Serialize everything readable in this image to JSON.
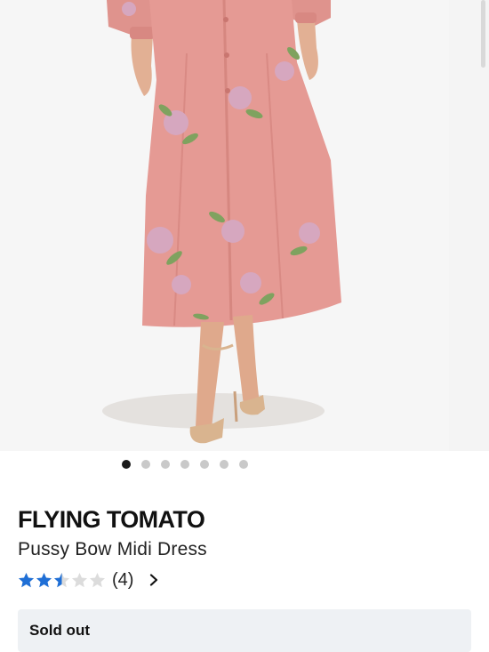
{
  "product": {
    "brand": "FLYING TOMATO",
    "name": "Pussy Bow Midi Dress",
    "rating": 2.5,
    "rating_max": 5,
    "review_count": "(4)",
    "availability": "Sold out"
  },
  "gallery": {
    "image_count": 7,
    "active_index": 0
  },
  "colors": {
    "star_filled": "#1f6fd6",
    "star_empty": "#dcdcdc",
    "dress": "#e59a94",
    "banner": "#eef1f4"
  },
  "icons": {
    "rating_star": "star-icon",
    "review_link": "chevron-right-icon"
  }
}
